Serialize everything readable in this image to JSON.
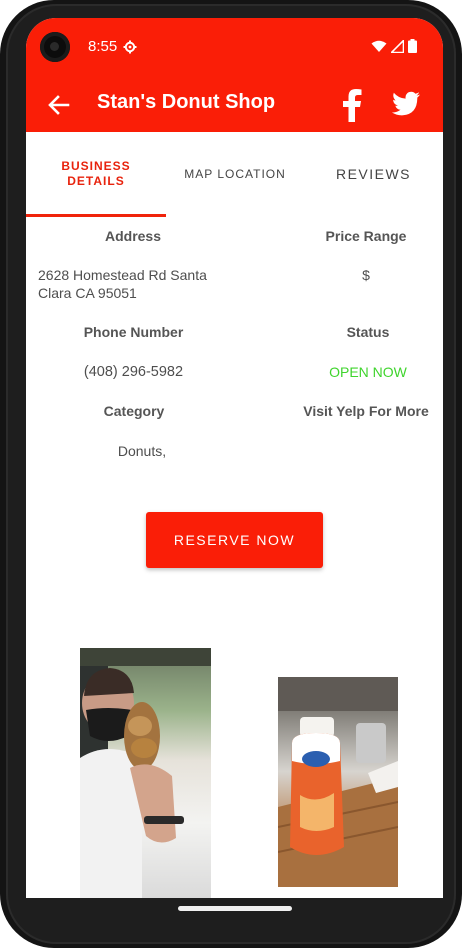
{
  "status_bar": {
    "time": "8:55"
  },
  "app_bar": {
    "title": "Stan's Donut Shop"
  },
  "tabs": [
    {
      "label": "BUSINESS DETAILS",
      "active": true
    },
    {
      "label": "MAP LOCATION",
      "active": false
    },
    {
      "label": "REVIEWS",
      "active": false
    }
  ],
  "details": {
    "address_label": "Address",
    "address_line1": "2628 Homestead Rd Santa",
    "address_line2": "Clara CA 95051",
    "price_label": "Price Range",
    "price_value": "$",
    "phone_label": "Phone Number",
    "phone_value": "(408) 296-5982",
    "status_label": "Status",
    "status_value": "OPEN NOW",
    "category_label": "Category",
    "category_value": "Donuts,",
    "yelp_label": "Visit Yelp For More"
  },
  "reserve_button": {
    "label": "RESERVE NOW"
  },
  "colors": {
    "brand_red": "#fa1e07",
    "open_green": "#3fd42d"
  },
  "icons": [
    "back-arrow-icon",
    "facebook-icon",
    "twitter-icon",
    "gear-icon",
    "wifi-icon",
    "signal-icon",
    "battery-icon"
  ]
}
